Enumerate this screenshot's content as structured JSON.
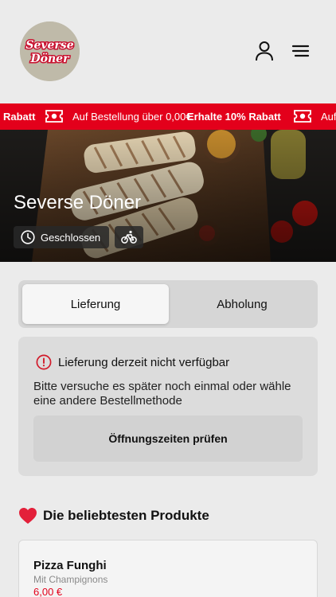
{
  "header": {
    "logo_text_line1": "Severse",
    "logo_text_line2": "Döner",
    "user_icon": "user-icon",
    "menu_icon": "hamburger-menu-icon"
  },
  "ticker": {
    "item_1": "Rabatt",
    "item_2": "Auf Bestellung über 0,00€",
    "item_3": "Erhalte 10% Rabatt",
    "item_4": "Auf",
    "icon": "discount-ticket-icon"
  },
  "hero": {
    "title": "Severse Döner",
    "status": "Geschlossen",
    "status_icon": "clock-icon",
    "delivery_icon": "bicycle-icon"
  },
  "order_mode": {
    "options": [
      "Lieferung",
      "Abholung"
    ],
    "selected": "Lieferung"
  },
  "notice": {
    "title": "Lieferung derzeit nicht verfügbar",
    "body": "Bitte versuche es später noch einmal oder wähle eine andere Bestellmethode",
    "button": "Öffnungszeiten prüfen",
    "icon": "info-circle-icon"
  },
  "popular": {
    "title": "Die beliebtesten Produkte",
    "icon": "heart-icon",
    "products": [
      {
        "name": "Pizza Funghi",
        "description": "Mit Champignons",
        "price": "6,00 €"
      }
    ]
  },
  "colors": {
    "brand_red": "#e3001b",
    "background": "#ebebeb"
  }
}
